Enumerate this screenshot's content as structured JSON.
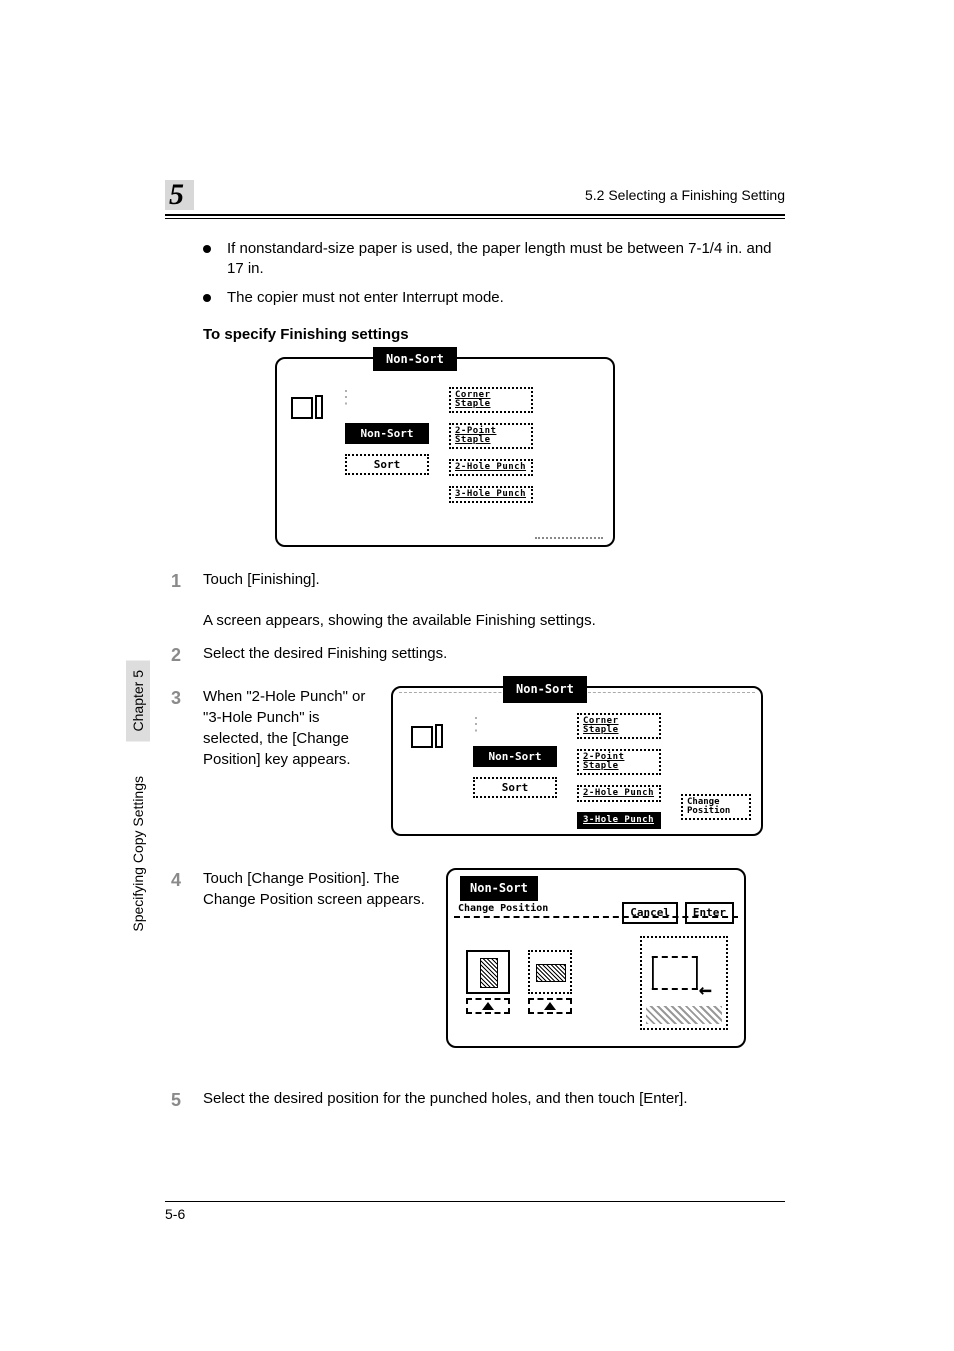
{
  "header": {
    "chapter_number": "5",
    "section_title": "5.2 Selecting a Finishing Setting"
  },
  "bullets": [
    "If nonstandard-size paper is used, the paper length must be between 7-1/4 in. and 17 in.",
    "The copier must not enter Interrupt mode."
  ],
  "section_heading": "To specify Finishing settings",
  "screenshot1": {
    "title": "Non-Sort",
    "col1": {
      "nonsort": "Non-Sort",
      "sort": "Sort"
    },
    "col2": {
      "corner": "Corner\nStaple",
      "twopoint": "2-Point\nStaple",
      "twohole": "2-Hole\nPunch",
      "threehole": "3-Hole\nPunch"
    }
  },
  "steps": {
    "s1": {
      "num": "1",
      "text": "Touch [Finishing].",
      "sub": "A screen appears, showing the available Finishing settings."
    },
    "s2": {
      "num": "2",
      "text": "Select the desired Finishing settings."
    },
    "s3": {
      "num": "3",
      "text": "When \"2-Hole Punch\" or \"3-Hole Punch\" is selected, the [Change Position] key appears."
    },
    "s4": {
      "num": "4",
      "text": "Touch [Change Position]. The Change Position screen appears."
    },
    "s5": {
      "num": "5",
      "text": "Select the desired position for the punched holes, and then touch [Enter]."
    }
  },
  "screenshot2": {
    "title": "Non-Sort",
    "change_position": "Change\nPosition",
    "col1": {
      "nonsort": "Non-Sort",
      "sort": "Sort"
    },
    "col2": {
      "corner": "Corner\nStaple",
      "twopoint": "2-Point\nStaple",
      "twohole": "2-Hole\nPunch",
      "threehole": "3-Hole\nPunch"
    }
  },
  "screenshot3": {
    "title": "Non-Sort",
    "subtitle": "Change\nPosition",
    "cancel": "Cancel",
    "enter": "Enter",
    "arrow": "←"
  },
  "sidebar": {
    "chapter": "Chapter 5",
    "label": "Specifying Copy Settings"
  },
  "footer": {
    "page": "5-6"
  }
}
